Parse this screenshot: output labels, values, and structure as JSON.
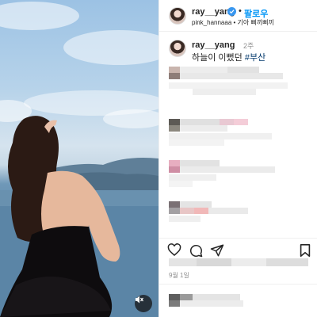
{
  "post": {
    "author": "ray__yang",
    "follow_label": "팔로우",
    "separator": "•",
    "audio_line": "pink_hannaaa • 기아 삐끼삐끼",
    "caption_author": "ray__yang",
    "caption_time": "2주",
    "caption_text": "하늘이 이뻤던 ",
    "caption_hashtag": "#부산",
    "date": "9월 1일"
  },
  "icons": {
    "verified": "verified-badge-icon",
    "mute": "speaker-muted-icon",
    "like": "heart-icon",
    "comment": "comment-bubble-icon",
    "share": "paper-plane-icon",
    "save": "bookmark-icon"
  },
  "colors": {
    "follow": "#0095f6",
    "verified": "#3897f0",
    "hashtag": "#00376b",
    "muted_text": "#8e8e8e"
  }
}
